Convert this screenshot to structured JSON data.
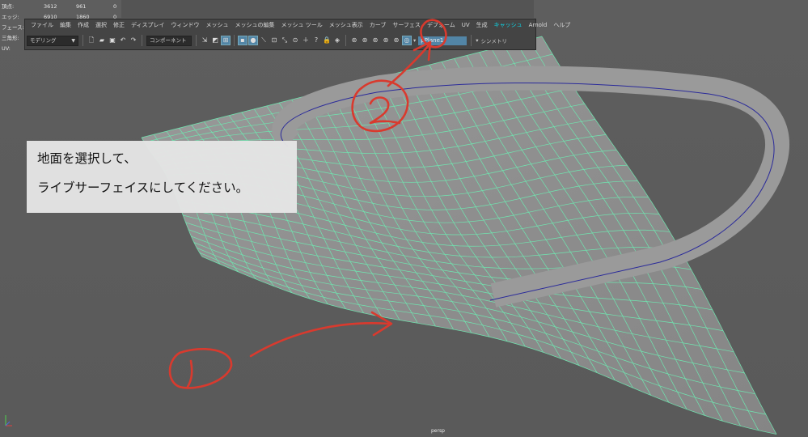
{
  "hud": {
    "rows": [
      {
        "label": "頂点:",
        "v1": "3612",
        "v2": "961",
        "v3": "0"
      },
      {
        "label": "エッジ:",
        "v1": "6910",
        "v2": "1860",
        "v3": "0"
      },
      {
        "label": "フェース:",
        "v1": "",
        "v2": "",
        "v3": ""
      },
      {
        "label": "三角形:",
        "v1": "",
        "v2": "",
        "v3": ""
      },
      {
        "label": "UV:",
        "v1": "",
        "v2": "",
        "v3": ""
      }
    ]
  },
  "menu": [
    "ファイル",
    "編集",
    "作成",
    "選択",
    "修正",
    "ディスプレイ",
    "ウィンドウ",
    "メッシュ",
    "メッシュの編集",
    "メッシュ ツール",
    "メッシュ表示",
    "カーブ",
    "サーフェス",
    "デフォーム",
    "UV",
    "生成",
    "キャッシュ",
    "Arnold",
    "ヘルプ"
  ],
  "toolbar": {
    "mode_dropdown": "モデリング",
    "component_label": "コンポーネント",
    "live_object_name": "pPlane1",
    "symmetry_label": "シンメトリ"
  },
  "note": {
    "line1": "地面を選択して、",
    "line2": "ライブサーフェイスにしてください。"
  },
  "annotations": {
    "one": "①",
    "two": "②"
  },
  "viewport": {
    "camera": "persp"
  },
  "colors": {
    "wire": "#6fe6b0",
    "curve": "#2a2a9a",
    "road": "#9a9a9a",
    "annotation": "#d93a2e",
    "selected": "#5285a6"
  }
}
